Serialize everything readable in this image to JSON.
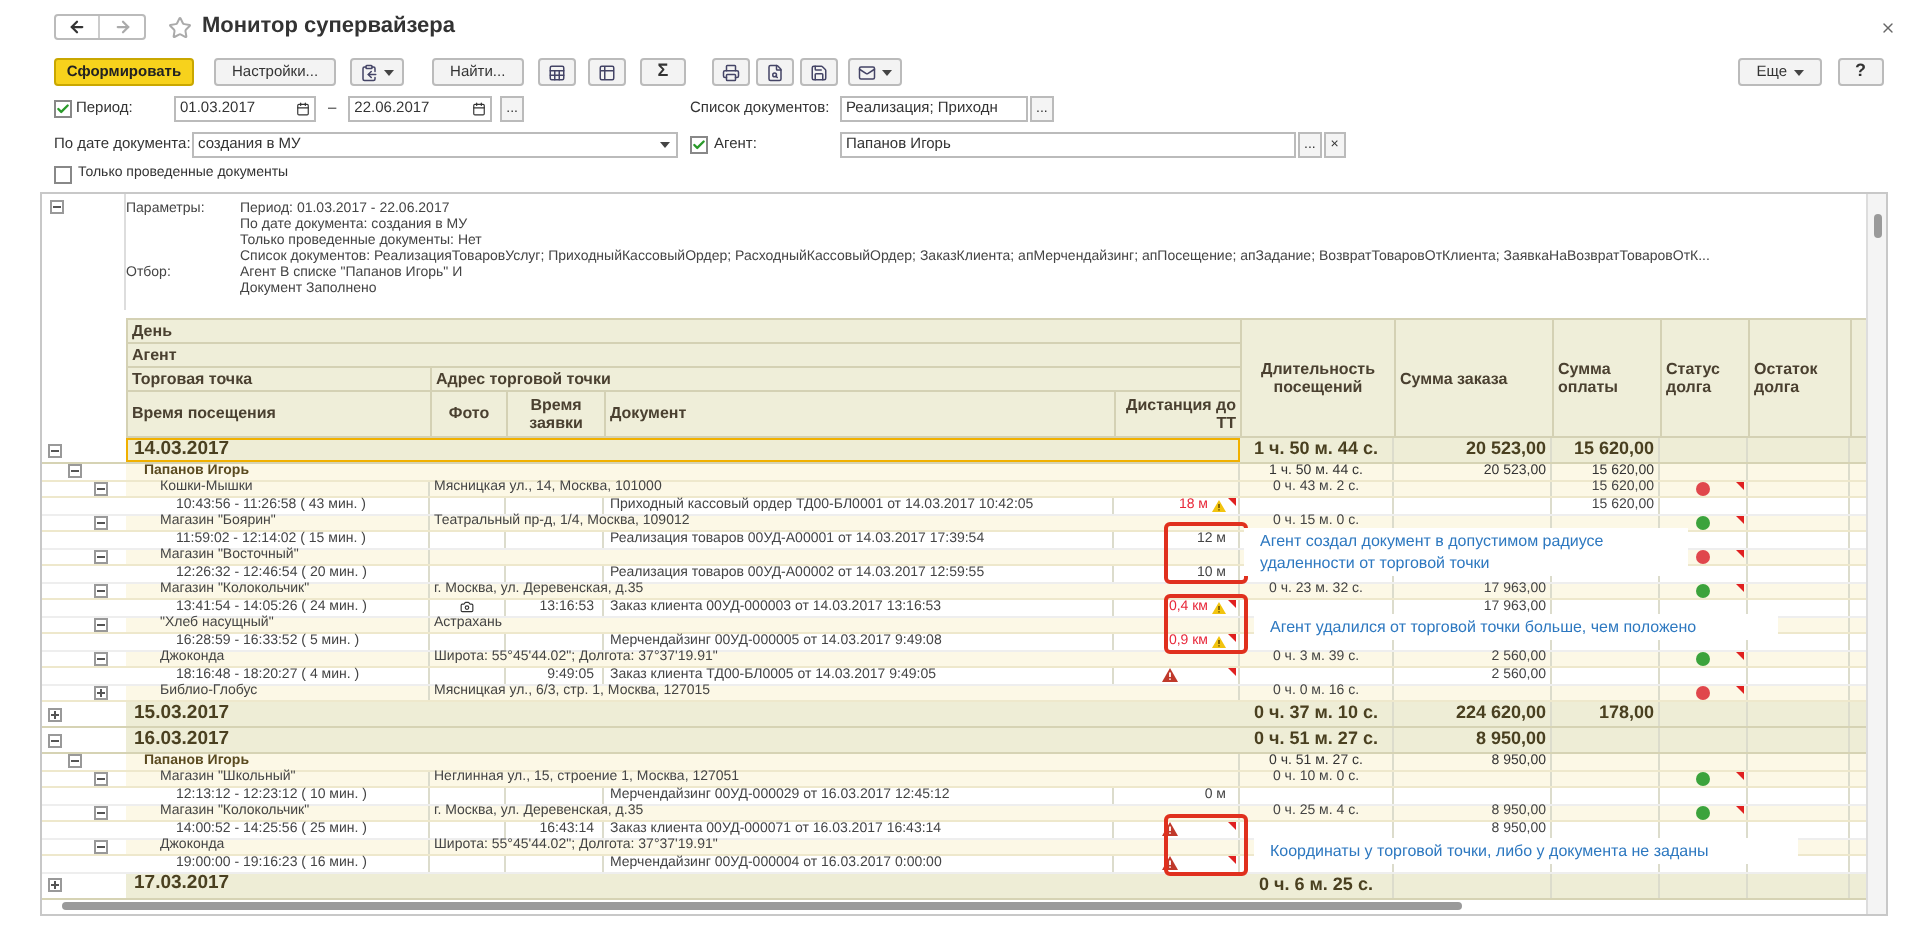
{
  "window": {
    "title": "Монитор супервайзера"
  },
  "toolbar": [
    {
      "kind": "primary",
      "label": "Сформировать",
      "dropdown": false
    },
    {
      "kind": "text",
      "label": "Настройки...",
      "dropdown": false
    },
    {
      "kind": "icon",
      "dropdown": true
    },
    {
      "kind": "text",
      "label": "Найти...",
      "dropdown": false
    },
    {
      "kind": "icon",
      "dropdown": false
    },
    {
      "kind": "icon",
      "dropdown": false
    },
    {
      "kind": "text",
      "label": "Σ",
      "dropdown": false
    },
    {
      "kind": "icon",
      "dropdown": false
    },
    {
      "kind": "icon",
      "dropdown": false
    },
    {
      "kind": "icon",
      "dropdown": false
    },
    {
      "kind": "icon",
      "dropdown": true
    }
  ],
  "toolbar_right": [
    {
      "kind": "text",
      "label": "Еще",
      "dropdown": true
    },
    {
      "kind": "text",
      "label": "?",
      "dropdown": false
    }
  ],
  "filters": {
    "period": {
      "checked": true,
      "label": "Период:",
      "from": "01.03.2017",
      "separator": "–",
      "to": "22.06.2017",
      "more": "..."
    },
    "documents": {
      "label": "Список документов:",
      "value": "Реализация; Приходн",
      "more": "..."
    },
    "date_basis": {
      "label": "По дате документа:",
      "value": "создания в МУ"
    },
    "agent": {
      "checked": true,
      "label": "Агент:",
      "value": "Папанов Игорь",
      "more": "...",
      "clear": "×"
    },
    "posted_only": {
      "checked": false,
      "label": "Только проведенные документы"
    }
  },
  "parameters": {
    "expanded": true,
    "lines": [
      {
        "label": "Параметры:",
        "text": "Период: 01.03.2017 - 22.06.2017"
      },
      {
        "text": "По дате документа: создания в МУ"
      },
      {
        "text": "Только проведенные документы: Нет"
      },
      {
        "text": "Список документов: РеализацияТоваровУслуг; ПриходныйКассовыйОрдер; РасходныйКассовыйОрдер; ЗаказКлиента; апМерчендайзинг; апПосещение; апЗадание; ВозвратТоваровОтКлиента; ЗаявкаНаВозвратТоваровОтК..."
      },
      {
        "label": "Отбор:",
        "text": "Агент В списке \"Папанов Игорь\" И"
      },
      {
        "text": "Документ Заполнено"
      }
    ]
  },
  "table": {
    "header": {
      "day": "День",
      "agent": "Агент",
      "point": "Торговая точка",
      "address": "Адрес торговой точки",
      "visit_time": "Время посещения",
      "photo": "Фото",
      "order_time": "Время заявки",
      "document": "Документ",
      "distance": "Дистанция до ТТ",
      "duration": "Длительность посещений",
      "order_sum": "Сумма заказа",
      "payment_sum": "Сумма оплаты",
      "debt_status": "Статус долга",
      "debt_rest": "Остаток долга"
    },
    "days": [
      {
        "date": "14.03.2017",
        "selected": true,
        "expanded": true,
        "duration": "1 ч. 50 м. 44 с.",
        "order_sum": "20 523,00",
        "payment_sum": "15 620,00",
        "children": [
          {
            "name": "Папанов Игорь",
            "expanded": true,
            "duration": "1 ч. 50 м. 44 с.",
            "order_sum": "20 523,00",
            "payment_sum": "15 620,00",
            "children": [
              {
                "name": "Кошки-Мышки",
                "address": "Мясницкая ул., 14, Москва, 101000",
                "expanded": true,
                "duration": "0 ч. 43 м. 2 с.",
                "payment_sum": "15 620,00",
                "color": "#e0474c",
                "children": [
                  {
                    "time": "10:43:56 - 11:26:58 ( 43 мин. )",
                    "photo": false,
                    "document": "Приходный кассовый ордер ТД00-БЛ0001 от 14.03.2017 10:42:05",
                    "distance": "18 м",
                    "kind": "far",
                    "payment_sum": "15 620,00"
                  }
                ]
              },
              {
                "name": "Магазин \"Боярин\"",
                "address": "Театральный пр-д, 1/4, Москва, 109012",
                "expanded": true,
                "duration": "0 ч. 15 м. 0 с.",
                "color": "#3ca33c",
                "children": [
                  {
                    "time": "11:59:02 - 12:14:02 ( 15 мин. )",
                    "photo": false,
                    "document": "Реализация товаров 00УД-А00001 от 14.03.2017 17:39:54",
                    "distance": "12 м",
                    "kind": "plain"
                  }
                ]
              },
              {
                "name": "Магазин \"Восточный\"",
                "expanded": true,
                "color": "#e0474c",
                "children": [
                  {
                    "time": "12:26:32 - 12:46:54 ( 20 мин. )",
                    "photo": false,
                    "document": "Реализация товаров 00УД-А00002 от 14.03.2017 12:59:55",
                    "distance": "10 м",
                    "kind": "plain"
                  }
                ]
              },
              {
                "name": "Магазин \"Колокольчик\"",
                "address": "г. Москва, ул. Деревенская, д.35",
                "expanded": true,
                "duration": "0 ч. 23 м. 32 с.",
                "order_sum": "17 963,00",
                "color": "#3ca33c",
                "children": [
                  {
                    "time": "13:41:54 - 14:05:26 ( 24 мин. )",
                    "photo": true,
                    "order_time": "13:16:53",
                    "document": "Заказ клиента 00УД-000003 от 14.03.2017 13:16:53",
                    "distance": "0,4 км",
                    "kind": "far",
                    "order_sum": "17 963,00"
                  }
                ]
              },
              {
                "name": "\"Хлеб насущный\"",
                "address": "Астрахань",
                "expanded": true,
                "children": [
                  {
                    "time": "16:28:59 - 16:33:52 ( 5 мин. )",
                    "photo": false,
                    "document": "Мерчендайзинг 00УД-000005 от 14.03.2017 9:49:08",
                    "distance": "0,9 км",
                    "kind": "far"
                  }
                ]
              },
              {
                "name": "Джоконда",
                "address": "Широта: 55°45'44.02\"; Долгота: 37°37'19.91\"",
                "expanded": true,
                "duration": "0 ч. 3 м. 39 с.",
                "order_sum": "2 560,00",
                "color": "#3ca33c",
                "children": [
                  {
                    "time": "18:16:48 - 18:20:27 ( 4 мин. )",
                    "photo": false,
                    "order_time": "9:49:05",
                    "document": "Заказ клиента ТД00-БЛ0005 от 14.03.2017 9:49:05",
                    "kind": "unset",
                    "order_sum": "2 560,00"
                  }
                ]
              },
              {
                "name": "Библио-Глобус",
                "address": "Мясницкая ул., 6/3, стр. 1, Москва, 127015",
                "expanded": false,
                "duration": "0 ч. 0 м. 16 с.",
                "color": "#e0474c"
              }
            ]
          }
        ]
      },
      {
        "date": "15.03.2017",
        "selected": false,
        "expanded": false,
        "duration": "0 ч. 37 м. 10 с.",
        "order_sum": "224 620,00",
        "payment_sum": "178,00"
      },
      {
        "date": "16.03.2017",
        "selected": false,
        "expanded": true,
        "duration": "0 ч. 51 м. 27 с.",
        "order_sum": "8 950,00",
        "children": [
          {
            "name": "Папанов Игорь",
            "expanded": true,
            "duration": "0 ч. 51 м. 27 с.",
            "order_sum": "8 950,00",
            "children": [
              {
                "name": "Магазин \"Школьный\"",
                "address": "Неглинная ул., 15, строение 1, Москва, 127051",
                "expanded": true,
                "duration": "0 ч. 10 м. 0 с.",
                "color": "#3ca33c",
                "children": [
                  {
                    "time": "12:13:12 - 12:23:12 ( 10 мин. )",
                    "photo": false,
                    "document": "Мерчендайзинг 00УД-000029 от 16.03.2017 12:45:12",
                    "distance": "0 м",
                    "kind": "plain"
                  }
                ]
              },
              {
                "name": "Магазин \"Колокольчик\"",
                "address": "г. Москва, ул. Деревенская, д.35",
                "expanded": true,
                "duration": "0 ч. 25 м. 4 с.",
                "order_sum": "8 950,00",
                "color": "#3ca33c",
                "children": [
                  {
                    "time": "14:00:52 - 14:25:56 ( 25 мин. )",
                    "photo": false,
                    "order_time": "16:43:14",
                    "document": "Заказ клиента 00УД-000071 от 16.03.2017 16:43:14",
                    "kind": "unset",
                    "order_sum": "8 950,00"
                  }
                ]
              },
              {
                "name": "Джоконда",
                "address": "Широта: 55°45'44.02\"; Долгота: 37°37'19.91\"",
                "expanded": true,
                "children": [
                  {
                    "time": "19:00:00 - 19:16:23 ( 16 мин. )",
                    "photo": false,
                    "document": "Мерчендайзинг 00УД-000004 от 16.03.2017 0:00:00",
                    "kind": "unset"
                  }
                ]
              }
            ]
          }
        ]
      },
      {
        "date": "17.03.2017",
        "selected": false,
        "expanded": false,
        "duration": "0 ч. 6 м. 25 с."
      }
    ]
  },
  "callouts": [
    {
      "text": "Агент создал документ в допустимом радиусе удаленности от торговой точки"
    },
    {
      "text": "Агент удалился от торговой точки больше, чем положено"
    },
    {
      "text": "Координаты у торговой точки, либо у документа не заданы"
    }
  ]
}
